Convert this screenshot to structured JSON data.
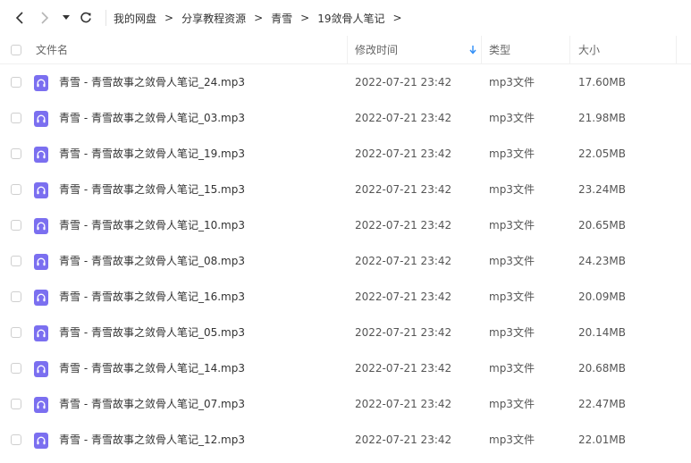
{
  "breadcrumb": {
    "items": [
      "我的网盘",
      "分享教程资源",
      "青雪",
      "19敛骨人笔记"
    ],
    "separator": ">"
  },
  "table": {
    "columns": {
      "name": "文件名",
      "modified": "修改时间",
      "type": "类型",
      "size": "大小"
    },
    "sort_column": "modified",
    "rows": [
      {
        "name": "青雪 - 青雪故事之敛骨人笔记_24.mp3",
        "modified": "2022-07-21 23:42",
        "type": "mp3文件",
        "size": "17.60MB"
      },
      {
        "name": "青雪 - 青雪故事之敛骨人笔记_03.mp3",
        "modified": "2022-07-21 23:42",
        "type": "mp3文件",
        "size": "21.98MB"
      },
      {
        "name": "青雪 - 青雪故事之敛骨人笔记_19.mp3",
        "modified": "2022-07-21 23:42",
        "type": "mp3文件",
        "size": "22.05MB"
      },
      {
        "name": "青雪 - 青雪故事之敛骨人笔记_15.mp3",
        "modified": "2022-07-21 23:42",
        "type": "mp3文件",
        "size": "23.24MB"
      },
      {
        "name": "青雪 - 青雪故事之敛骨人笔记_10.mp3",
        "modified": "2022-07-21 23:42",
        "type": "mp3文件",
        "size": "20.65MB"
      },
      {
        "name": "青雪 - 青雪故事之敛骨人笔记_08.mp3",
        "modified": "2022-07-21 23:42",
        "type": "mp3文件",
        "size": "24.23MB"
      },
      {
        "name": "青雪 - 青雪故事之敛骨人笔记_16.mp3",
        "modified": "2022-07-21 23:42",
        "type": "mp3文件",
        "size": "20.09MB"
      },
      {
        "name": "青雪 - 青雪故事之敛骨人笔记_05.mp3",
        "modified": "2022-07-21 23:42",
        "type": "mp3文件",
        "size": "20.14MB"
      },
      {
        "name": "青雪 - 青雪故事之敛骨人笔记_14.mp3",
        "modified": "2022-07-21 23:42",
        "type": "mp3文件",
        "size": "20.68MB"
      },
      {
        "name": "青雪 - 青雪故事之敛骨人笔记_07.mp3",
        "modified": "2022-07-21 23:42",
        "type": "mp3文件",
        "size": "22.47MB"
      },
      {
        "name": "青雪 - 青雪故事之敛骨人笔记_12.mp3",
        "modified": "2022-07-21 23:42",
        "type": "mp3文件",
        "size": "22.01MB"
      }
    ]
  },
  "icons": {
    "back": "chevron-left-icon",
    "forward": "chevron-right-icon",
    "history": "caret-down-icon",
    "refresh": "refresh-icon",
    "sort": "arrow-down-icon",
    "file": "audio-file-icon"
  },
  "colors": {
    "accent": "#2f8ef7",
    "audio_icon": "#7b6ff0"
  }
}
